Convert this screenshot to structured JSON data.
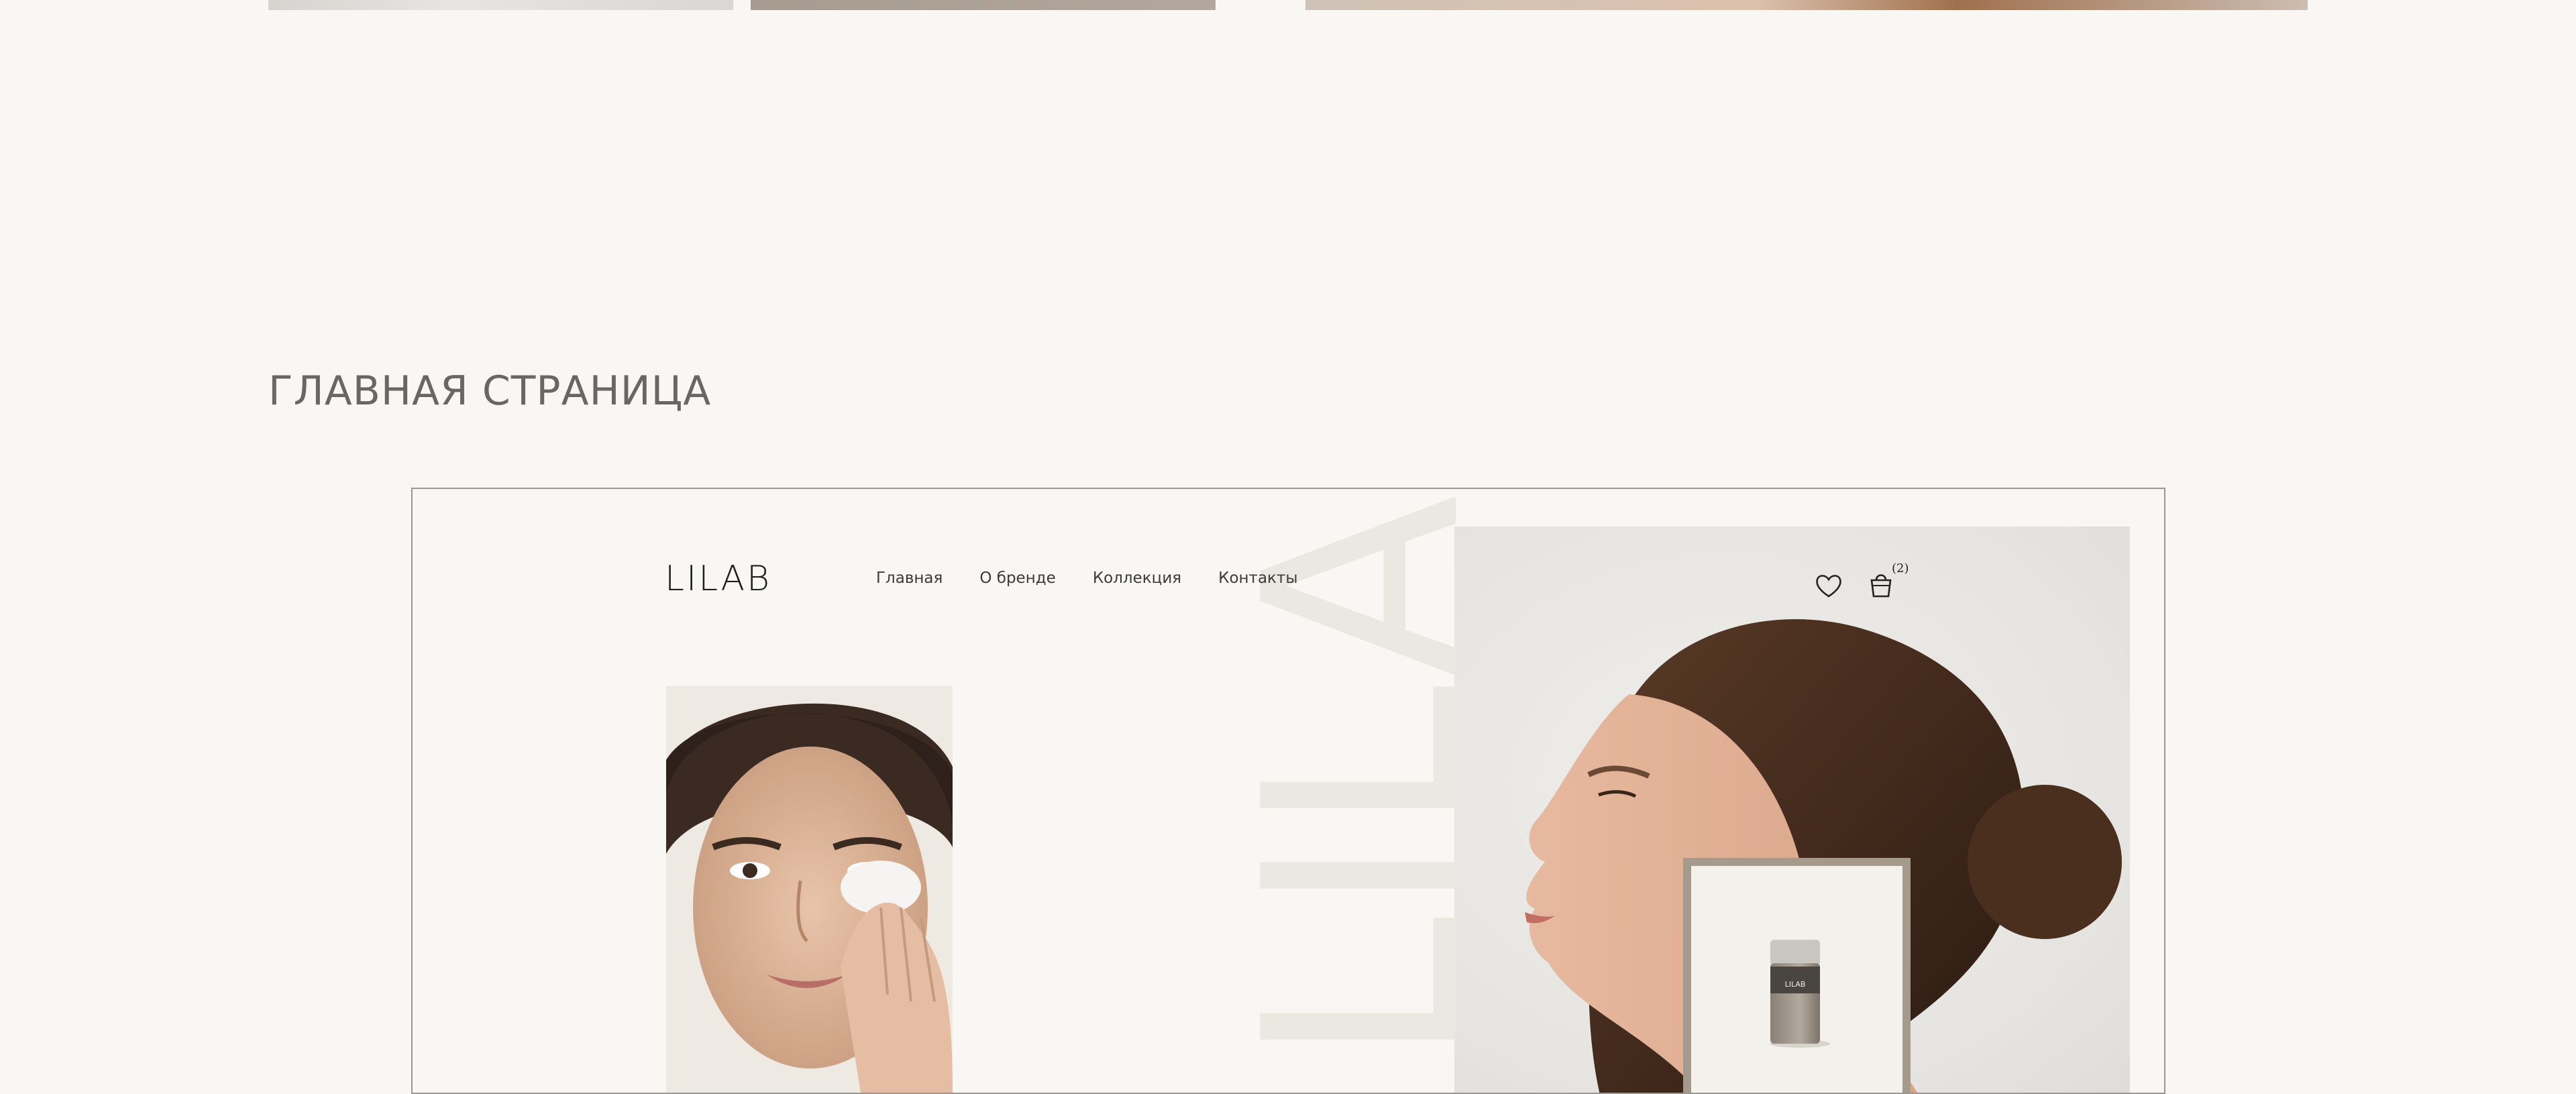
{
  "section": {
    "title": "ГЛАВНАЯ СТРАНИЦА"
  },
  "mockup": {
    "logo": "LILAB",
    "nav": [
      "Главная",
      "О бренде",
      "Коллекция",
      "Контакты"
    ],
    "cart_count": "(2)",
    "watermark": "LILAB",
    "product_label": "LILAB"
  },
  "icons": [
    "heart-icon",
    "shopping-bag-icon"
  ],
  "colors": {
    "background": "#f8f7f4",
    "title": "#6a6762",
    "frame": "#9a9893",
    "product_card": "#a59a8e"
  }
}
